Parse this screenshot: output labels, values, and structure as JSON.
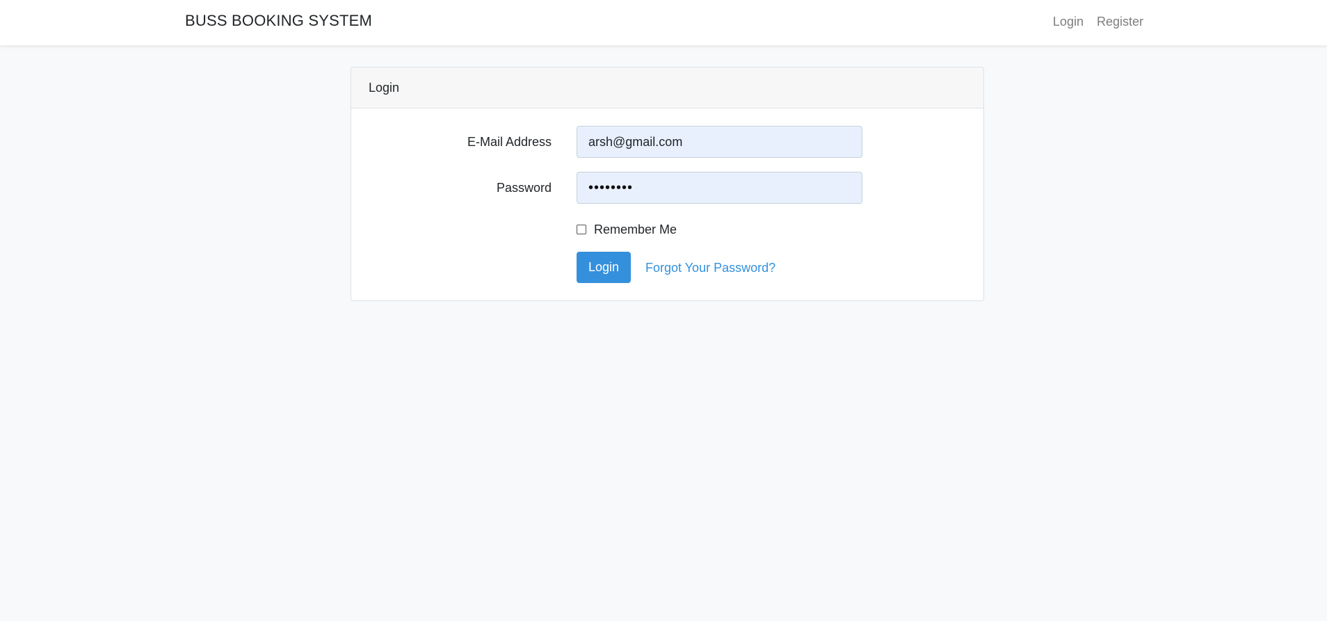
{
  "navbar": {
    "brand": "BUSS BOOKING SYSTEM",
    "links": [
      {
        "label": "Login"
      },
      {
        "label": "Register"
      }
    ]
  },
  "card": {
    "header": "Login",
    "email": {
      "label": "E-Mail Address",
      "value": "arsh@gmail.com"
    },
    "password": {
      "label": "Password",
      "masked_value": "••••••••"
    },
    "remember": {
      "label": "Remember Me",
      "checked": false
    },
    "login_button": "Login",
    "forgot_link": "Forgot Your Password?"
  },
  "colors": {
    "accent": "#3490dc",
    "page_bg": "#f8f9fb",
    "input_bg": "#e8f0fe"
  }
}
